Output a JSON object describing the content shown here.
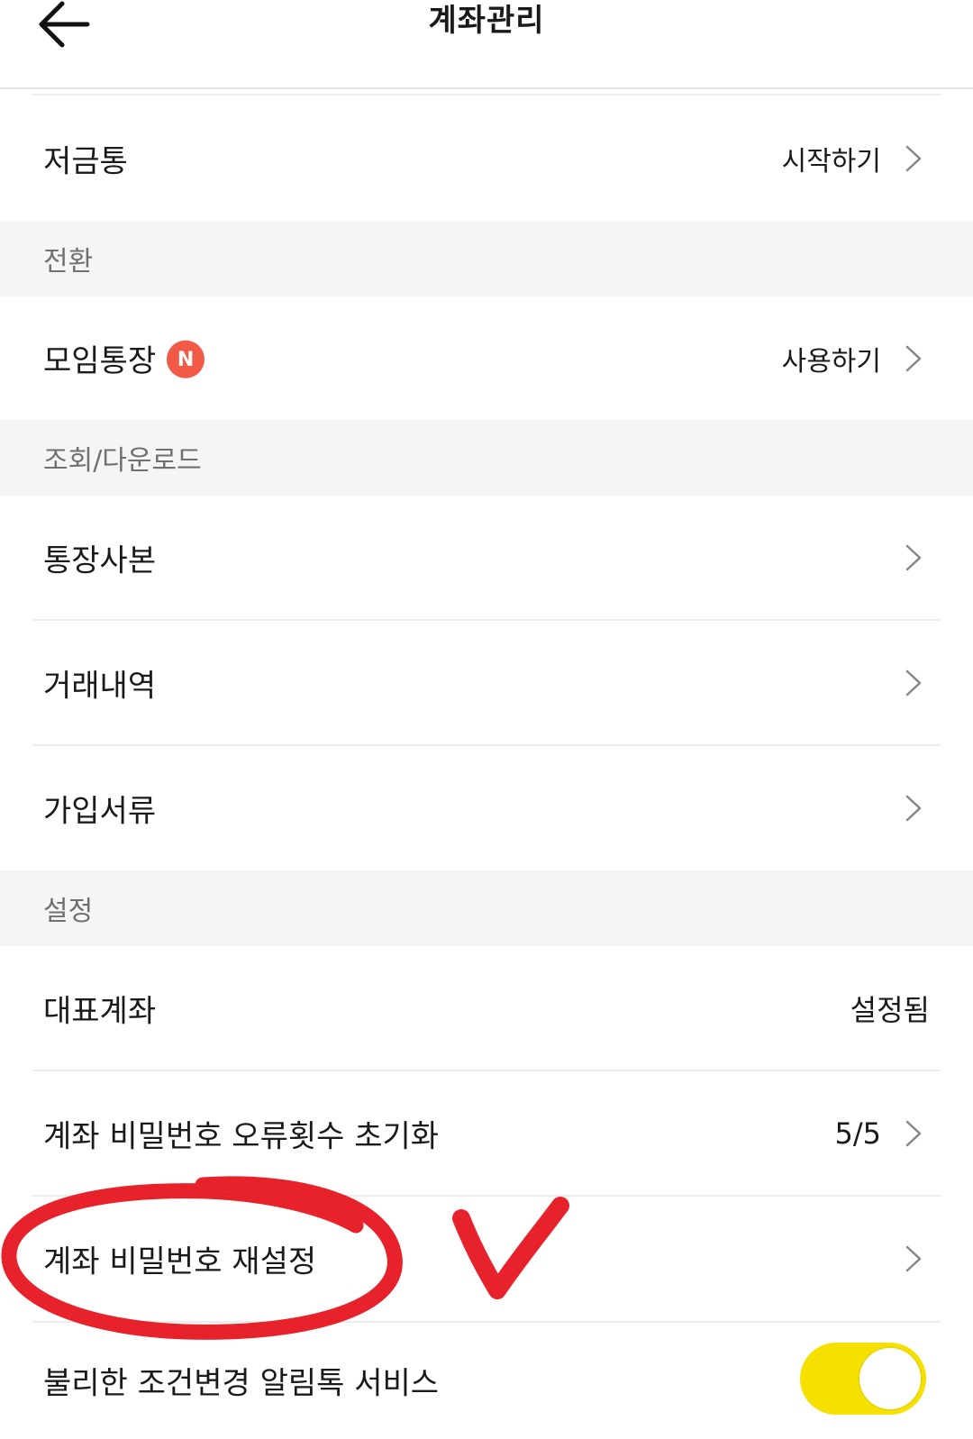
{
  "header": {
    "title": "계좌관리"
  },
  "rows": {
    "piggy_bank": {
      "label": "저금통",
      "action": "시작하기"
    },
    "group_account": {
      "label": "모임통장",
      "badge": "N",
      "action": "사용하기"
    },
    "passbook_copy": {
      "label": "통장사본"
    },
    "transactions": {
      "label": "거래내역"
    },
    "signup_docs": {
      "label": "가입서류"
    },
    "main_account": {
      "label": "대표계좌",
      "value": "설정됨"
    },
    "pw_error_reset": {
      "label": "계좌 비밀번호 오류횟수 초기화",
      "value": "5/5"
    },
    "pw_reset": {
      "label": "계좌 비밀번호 재설정"
    },
    "alert_service": {
      "label": "불리한 조건변경 알림톡 서비스",
      "toggle_on": true
    }
  },
  "sections": {
    "switch": "전환",
    "view_download": "조회/다운로드",
    "settings": "설정"
  },
  "colors": {
    "section_bg": "#f4f5f5",
    "badge": "#f15a47",
    "toggle": "#f6e000",
    "annotation": "#e8222a"
  }
}
